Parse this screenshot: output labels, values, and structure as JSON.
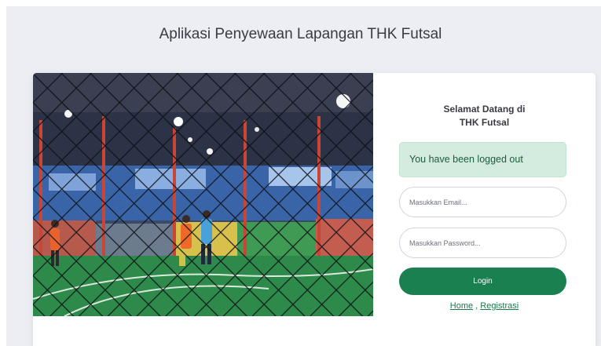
{
  "header": {
    "title": "Aplikasi Penyewaan Lapangan THK Futsal"
  },
  "login_card": {
    "photo_icon": "futsal-court-photo",
    "welcome_line1": "Selamat Datang di",
    "welcome_line2": "THK Futsal",
    "alert_text": "You have been logged out",
    "email_placeholder": "Masukkan Email...",
    "password_placeholder": "Masukkan Password...",
    "login_label": "Login",
    "links": {
      "home": "Home",
      "separator": " , ",
      "register": "Registrasi"
    }
  },
  "colors": {
    "page_background": "#eceef3",
    "primary_button": "#1a8050",
    "alert_background": "#d4ecdf",
    "alert_text": "#1d5c3d",
    "link": "#1a7a4c"
  }
}
